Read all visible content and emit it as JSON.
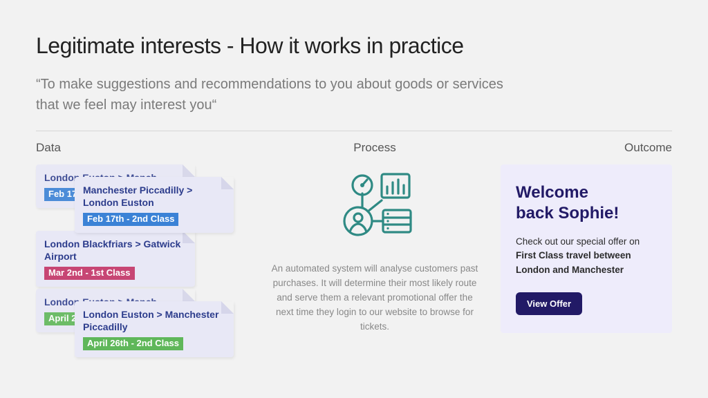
{
  "title": "Legitimate interests - How it works in practice",
  "quote": "“To make suggestions and recommendations to you about goods or services that we feel may interest you“",
  "columns": {
    "data": "Data",
    "process": "Process",
    "outcome": "Outcome"
  },
  "tickets": [
    {
      "back": {
        "route": "London Euston > Manch",
        "tag": "Feb 17t",
        "color": "blue"
      },
      "front": {
        "route": "Manchester Piccadilly > London Euston",
        "tag": "Feb 17th - 2nd Class",
        "color": "blue"
      }
    },
    {
      "single": {
        "route": "London Blackfriars > Gatwick Airport",
        "tag": "Mar 2nd  - 1st Class",
        "color": "pink"
      }
    },
    {
      "back": {
        "route": "London Euston > Manch",
        "tag": "April 23",
        "color": "green"
      },
      "front": {
        "route": "London Euston > Manchester Piccadilly",
        "tag": "April 26th - 2nd Class",
        "color": "green"
      }
    }
  ],
  "process_text": "An automated system will analyse customers past purchases. It will determine their most likely route and serve them a relevant promotional offer the next time they login to our website to browse for tickets.",
  "offer": {
    "heading_l1": "Welcome",
    "heading_l2": "back Sophie!",
    "body_pre": "Check out our special offer on ",
    "body_bold": "First Class travel between London and Manchester",
    "cta": "View Offer"
  }
}
